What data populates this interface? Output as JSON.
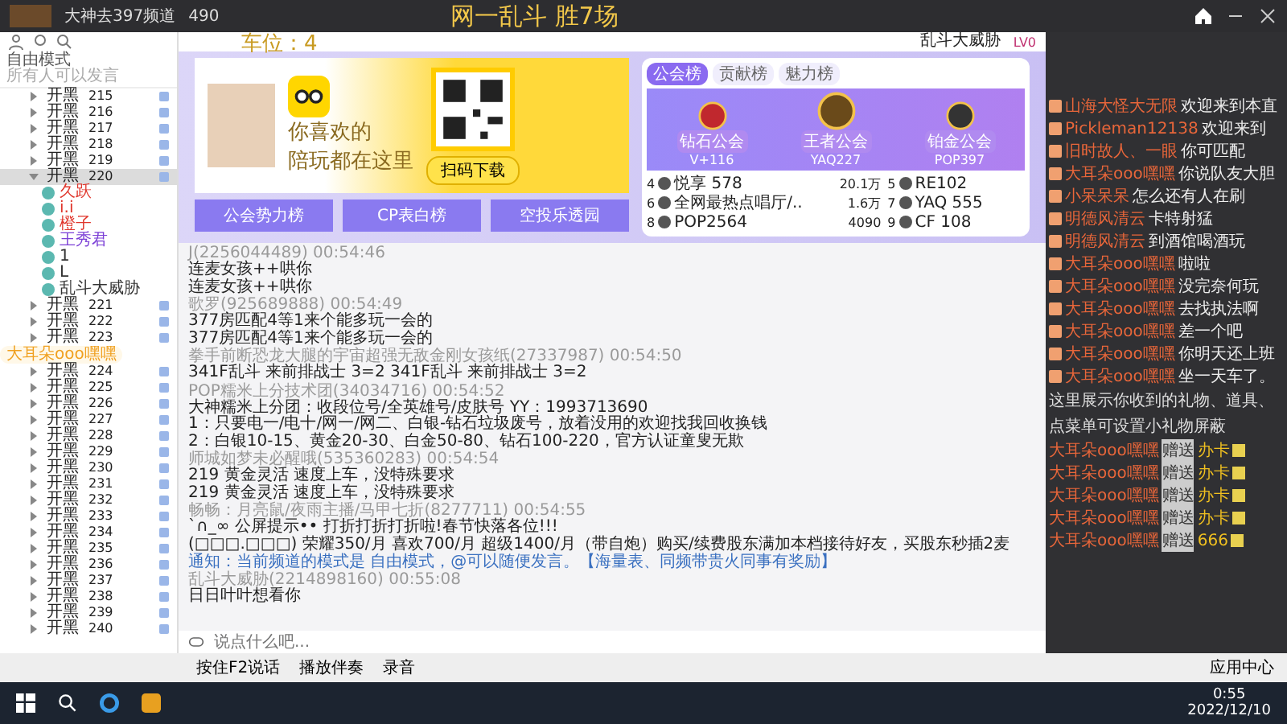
{
  "top_bar": {
    "channel_info": "大神去397频道",
    "online_count": "490"
  },
  "stream_overlay": {
    "line_1": "网一乱斗 胜7场",
    "line_2": "车位：4",
    "floating_name": "大耳朵ooo嘿嘿"
  },
  "header_user": {
    "name": "乱斗大威胁",
    "level": "LV0"
  },
  "sidebar": {
    "mode": "自由模式",
    "hint": "所有人可以发言",
    "rooms": [
      {
        "label": "开黑",
        "number": "215",
        "selected": false,
        "expanded": false
      },
      {
        "label": "开黑",
        "number": "216",
        "selected": false,
        "expanded": false
      },
      {
        "label": "开黑",
        "number": "217",
        "selected": false,
        "expanded": false
      },
      {
        "label": "开黑",
        "number": "218",
        "selected": false,
        "expanded": false
      },
      {
        "label": "开黑",
        "number": "219",
        "selected": false,
        "expanded": false
      },
      {
        "label": "开黑",
        "number": "220",
        "selected": true,
        "expanded": true,
        "members": [
          {
            "name": "久跃",
            "color": "#e0362c"
          },
          {
            "name": "i.i",
            "color": "#e0362c"
          },
          {
            "name": "橙子",
            "color": "#e0362c"
          },
          {
            "name": "王秀君",
            "color": "#7b3fd6"
          },
          {
            "name": "1",
            "color": "#333333"
          },
          {
            "name": "L",
            "color": "#333333"
          },
          {
            "name": "乱斗大威胁",
            "color": "#333333"
          }
        ]
      },
      {
        "label": "开黑",
        "number": "221",
        "selected": false,
        "expanded": false
      },
      {
        "label": "开黑",
        "number": "222",
        "selected": false,
        "expanded": false
      },
      {
        "label": "开黑",
        "number": "223",
        "selected": false,
        "expanded": false
      },
      {
        "label": "开黑",
        "number": "224",
        "selected": false,
        "expanded": false
      },
      {
        "label": "开黑",
        "number": "225",
        "selected": false,
        "expanded": false
      },
      {
        "label": "开黑",
        "number": "226",
        "selected": false,
        "expanded": false
      },
      {
        "label": "开黑",
        "number": "227",
        "selected": false,
        "expanded": false
      },
      {
        "label": "开黑",
        "number": "228",
        "selected": false,
        "expanded": false
      },
      {
        "label": "开黑",
        "number": "229",
        "selected": false,
        "expanded": false
      },
      {
        "label": "开黑",
        "number": "230",
        "selected": false,
        "expanded": false
      },
      {
        "label": "开黑",
        "number": "231",
        "selected": false,
        "expanded": false
      },
      {
        "label": "开黑",
        "number": "232",
        "selected": false,
        "expanded": false
      },
      {
        "label": "开黑",
        "number": "233",
        "selected": false,
        "expanded": false
      },
      {
        "label": "开黑",
        "number": "234",
        "selected": false,
        "expanded": false
      },
      {
        "label": "开黑",
        "number": "235",
        "selected": false,
        "expanded": false
      },
      {
        "label": "开黑",
        "number": "236",
        "selected": false,
        "expanded": false
      },
      {
        "label": "开黑",
        "number": "237",
        "selected": false,
        "expanded": false
      },
      {
        "label": "开黑",
        "number": "238",
        "selected": false,
        "expanded": false
      },
      {
        "label": "开黑",
        "number": "239",
        "selected": false,
        "expanded": false
      },
      {
        "label": "开黑",
        "number": "240",
        "selected": false,
        "expanded": false
      }
    ]
  },
  "banner": {
    "slogan_1": "你喜欢的",
    "slogan_2": "陪玩都在这里",
    "download_button": "扫码下载"
  },
  "quick_buttons": [
    "公会势力榜",
    "CP表白榜",
    "空投乐透园"
  ],
  "ranking": {
    "tabs": [
      {
        "label": "公会榜",
        "selected": true
      },
      {
        "label": "贡献榜",
        "selected": false
      },
      {
        "label": "魅力榜",
        "selected": false
      }
    ],
    "podium": [
      {
        "name": "V+116",
        "badge": "钻石公会"
      },
      {
        "name": "YAQ227",
        "badge": "王者公会"
      },
      {
        "name": "POP397",
        "badge": "铂金公会"
      }
    ],
    "rows": [
      {
        "rank": "4",
        "name": "悦享 578",
        "score": "20.1万"
      },
      {
        "rank": "5",
        "name": "RE102"
      },
      {
        "rank": "6",
        "name": "全网最热点唱厅/..",
        "score": "1.6万"
      },
      {
        "rank": "7",
        "name": "YAQ 555"
      },
      {
        "rank": "8",
        "name": "POP2564",
        "score": "4090"
      },
      {
        "rank": "9",
        "name": "CF 108"
      }
    ]
  },
  "chat": {
    "messages": [
      {
        "kind": "user",
        "header": "J(2256044489) 00:54:46",
        "lines": [
          "连麦女孩++哄你",
          "连麦女孩++哄你"
        ]
      },
      {
        "kind": "user",
        "header": "歌罗(925689888) 00:54:49",
        "lines": [
          "377房匹配4等1来个能多玩一会的",
          "377房匹配4等1来个能多玩一会的"
        ]
      },
      {
        "kind": "user",
        "header": "拳手前断恐龙大腿的宇宙超强无敌金刚女孩纸(27337987) 00:54:50",
        "lines": [
          "341F乱斗 来前排战士 3=2  341F乱斗 来前排战士 3=2"
        ]
      },
      {
        "kind": "user",
        "header": "POP糯米上分技术团(34034716) 00:54:52",
        "lines": [
          "大神糯米上分团：收段位号/全英雄号/皮肤号 YY：1993713690",
          "1：只要电一/电十/网一/网二、白银-钻石垃圾废号，放着没用的欢迎找我回收换钱",
          "2：白银10-15、黄金20-30、白金50-80、钻石100-220，官方认证童叟无欺"
        ]
      },
      {
        "kind": "user",
        "header": "师城如梦未必醒哦(535360283) 00:54:54",
        "lines": [
          "219 黄金灵活 速度上车，没特殊要求",
          "219 黄金灵活 速度上车，没特殊要求"
        ]
      },
      {
        "kind": "user",
        "header": "畅畅：月亮鼠/夜雨主播/马甲七折(8277711) 00:54:55",
        "lines": [
          "`∩_∞   公屏提示••          打折打折打折啦!春节快落各位!!!",
          "(□□□.□□□)    荣耀350/月 喜欢700/月 超级1400/月（带自炮）购买/续费股东满加本档接待好友，买股东秒插2麦"
        ]
      },
      {
        "kind": "notice",
        "header": "通知：当前频道的模式是 自由模式，@可以随便发言。【海量表、同频带贵火同事有奖励】"
      },
      {
        "kind": "user",
        "header": "乱斗大威胁(2214898160) 00:55:08",
        "lines": [
          "日日叶叶想看你"
        ]
      }
    ],
    "placeholder": "说点什么吧..."
  },
  "bottom_toolbar": {
    "buttons": [
      "按住F2说话",
      "播放伴奏",
      "录音"
    ],
    "app_center": "应用中心"
  },
  "right_panel": {
    "messages": [
      {
        "name": "山海大怪大无限",
        "text": "欢迎来到本直"
      },
      {
        "name": "Pickleman12138",
        "text": "欢迎来到"
      },
      {
        "name": "旧时故人、一眼",
        "text": "你可匹配"
      },
      {
        "name": "大耳朵ooo嘿嘿",
        "text": "你说队友大胆"
      },
      {
        "name": "小呆呆呆",
        "text": "怎么还有人在刷"
      },
      {
        "name": "明德风清云",
        "text": "卡特射猛"
      },
      {
        "name": "明德风清云",
        "text": "到酒馆喝酒玩"
      },
      {
        "name": "大耳朵ooo嘿嘿",
        "text": "啦啦"
      },
      {
        "name": "大耳朵ooo嘿嘿",
        "text": "没完奈何玩"
      },
      {
        "name": "大耳朵ooo嘿嘿",
        "text": "去找执法啊"
      },
      {
        "name": "大耳朵ooo嘿嘿",
        "text": "差一个吧"
      },
      {
        "name": "大耳朵ooo嘿嘿",
        "text": "你明天还上班"
      },
      {
        "name": "大耳朵ooo嘿嘿",
        "text": "坐一天车了。"
      }
    ],
    "gift_notice": "这里展示你收到的礼物、道具、",
    "gift_hint": "点菜单可设置小礼物屏蔽",
    "gifts": [
      {
        "name": "大耳朵ooo嘿嘿",
        "action": "赠送",
        "item": "办卡"
      },
      {
        "name": "大耳朵ooo嘿嘿",
        "action": "赠送",
        "item": "办卡"
      },
      {
        "name": "大耳朵ooo嘿嘿",
        "action": "赠送",
        "item": "办卡"
      },
      {
        "name": "大耳朵ooo嘿嘿",
        "action": "赠送",
        "item": "办卡"
      },
      {
        "name": "大耳朵ooo嘿嘿",
        "action": "赠送",
        "item": "666"
      }
    ]
  },
  "taskbar": {
    "time": "0:55",
    "date": "2022/12/10"
  }
}
